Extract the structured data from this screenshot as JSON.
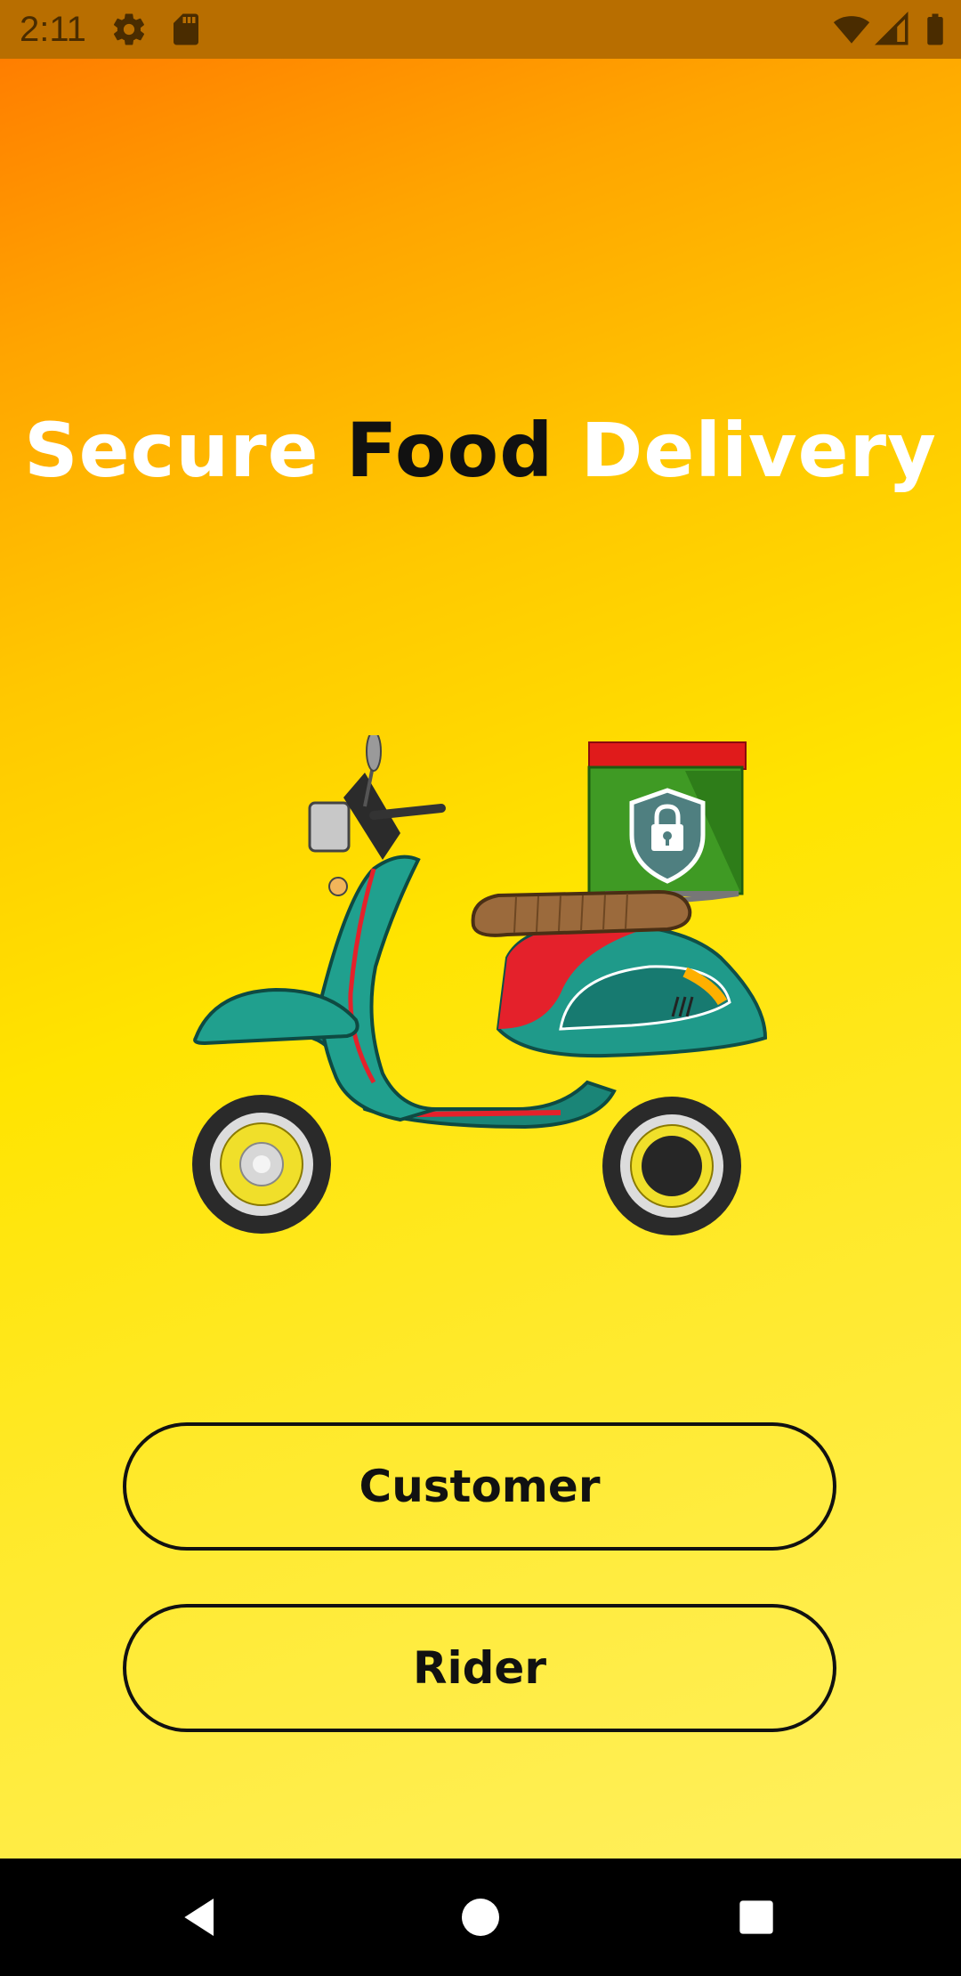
{
  "status_bar": {
    "time": "2:11",
    "icons": [
      "settings-gear-icon",
      "sd-card-icon",
      "wifi-icon",
      "cellular-signal-icon",
      "battery-icon"
    ]
  },
  "title": {
    "word1": "Secure",
    "word2": "Food",
    "word3": "Delivery"
  },
  "illustration": "delivery-scooter-with-lock-box",
  "buttons": {
    "customer_label": "Customer",
    "rider_label": "Rider"
  },
  "nav_bar": {
    "icons": [
      "back-icon",
      "home-icon",
      "recents-icon"
    ]
  },
  "colors": {
    "gradient_top": "#ff7e00",
    "gradient_mid": "#ffe400",
    "gradient_bottom": "#fff060",
    "title_white": "#ffffff",
    "title_dark": "#111111",
    "button_border": "#111111"
  }
}
